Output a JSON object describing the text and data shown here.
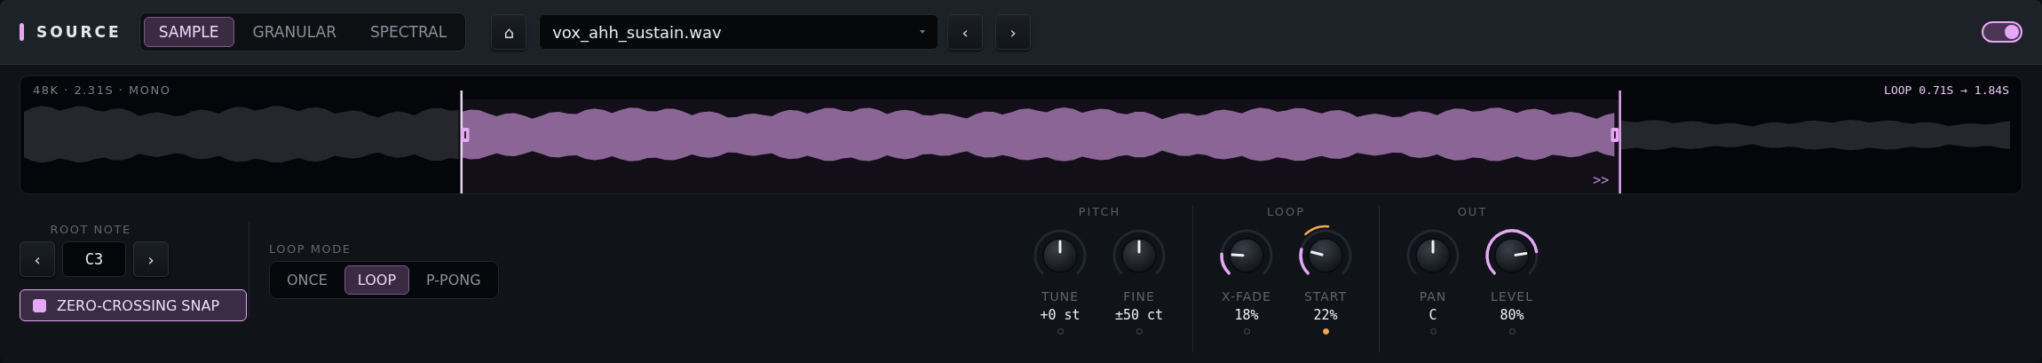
{
  "header": {
    "title": "SOURCE",
    "tabs": [
      {
        "label": "SAMPLE",
        "selected": true
      },
      {
        "label": "GRANULAR",
        "selected": false
      },
      {
        "label": "SPECTRAL",
        "selected": false
      }
    ],
    "home_button": "⌂",
    "file": {
      "value": "vox_ahh_sustain.wav"
    },
    "prev_button": "‹",
    "next_button": "›",
    "power": {
      "on": true
    }
  },
  "waveform": {
    "info": "48K · 2.31S · MONO",
    "loop_label": "LOOP 0.71S → 1.84S",
    "marker": ">>"
  },
  "root_note": {
    "label": "ROOT NOTE",
    "prev": "‹",
    "value": "C3",
    "next": "›"
  },
  "snap": {
    "label": "ZERO-CROSSING SNAP",
    "checked": true
  },
  "loop_mode": {
    "label": "LOOP MODE",
    "options": [
      {
        "label": "ONCE",
        "selected": false
      },
      {
        "label": "LOOP",
        "selected": true
      },
      {
        "label": "P-PONG",
        "selected": false
      }
    ]
  },
  "sections": [
    {
      "title": "PITCH",
      "knobs": [
        {
          "label": "TUNE",
          "value": "+0 st",
          "kind": "bipolar",
          "modulated": false
        },
        {
          "label": "FINE",
          "value": "±50 ct",
          "kind": "bipolar",
          "modulated": false
        }
      ]
    },
    {
      "title": "LOOP",
      "knobs": [
        {
          "label": "X-FADE",
          "value": "18%",
          "kind": "unipolar",
          "modulated": false
        },
        {
          "label": "START",
          "value": "22%",
          "kind": "unipolar",
          "modulated": true
        }
      ]
    },
    {
      "title": "OUT",
      "knobs": [
        {
          "label": "PAN",
          "value": "C",
          "kind": "bipolar",
          "modulated": false
        },
        {
          "label": "LEVEL",
          "value": "80%",
          "kind": "unipolar",
          "modulated": false
        }
      ]
    }
  ]
}
